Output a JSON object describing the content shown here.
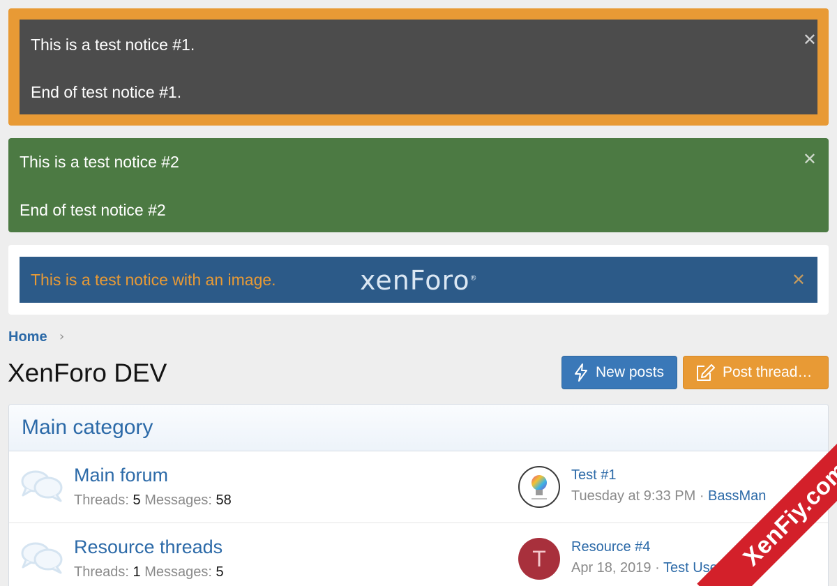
{
  "notices": [
    {
      "line1": "This is a test notice #1.",
      "line2": "End of test notice #1.",
      "close": "✕"
    },
    {
      "line1": "This is a test notice #2",
      "line2": "End of test notice #2",
      "close": "✕"
    },
    {
      "text": "This is a test notice with an image.",
      "logo": "xenForo",
      "logo_mark": "®",
      "close": "✕"
    }
  ],
  "breadcrumb": {
    "home": "Home",
    "separator": "›"
  },
  "page": {
    "title": "XenForo DEV"
  },
  "buttons": {
    "new_posts": "New posts",
    "post_thread": "Post thread…"
  },
  "category": {
    "title": "Main category",
    "forums": [
      {
        "name": "Main forum",
        "threads_label": "Threads:",
        "threads": "5",
        "messages_label": "Messages:",
        "messages": "58",
        "latest_title": "Test #1",
        "latest_date": "Tuesday at 9:33 PM",
        "latest_sep": "·",
        "latest_user": "BassMan"
      },
      {
        "name": "Resource threads",
        "threads_label": "Threads:",
        "threads": "1",
        "messages_label": "Messages:",
        "messages": "5",
        "latest_title": "Resource #4",
        "latest_date": "Apr 18, 2019",
        "latest_sep": "·",
        "latest_user": "Test User",
        "avatar_letter": "T"
      }
    ]
  },
  "watermark": "XenFiy.com",
  "colors": {
    "accent_orange": "#e89a35",
    "link_blue": "#2c6aa8",
    "notice_green": "#4c7a43",
    "notice_dark": "#4c4c4c",
    "notice_blue": "#2c5a88",
    "avatar_red": "#a8303c"
  }
}
